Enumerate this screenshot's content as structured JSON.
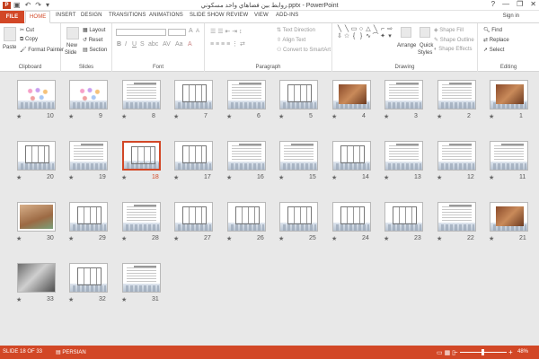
{
  "window": {
    "title": "روابط بين فضاهاي واحد مسكوني.pptx - PowerPoint",
    "app_badge": "P",
    "sign_in": "Sign in",
    "help": "?",
    "minimize": "—",
    "restore": "❐",
    "close": "✕"
  },
  "qat": {
    "save": "▣",
    "undo": "↶",
    "redo": "↷",
    "customize": "▾"
  },
  "tabs": [
    "FILE",
    "HOME",
    "INSERT",
    "DESIGN",
    "TRANSITIONS",
    "ANIMATIONS",
    "SLIDE SHOW",
    "REVIEW",
    "VIEW",
    "ADD-INS"
  ],
  "ribbon": {
    "clipboard": {
      "label": "Clipboard",
      "paste": "Paste",
      "cut": "Cut",
      "copy": "Copy",
      "format_painter": "Format Painter"
    },
    "slides": {
      "label": "Slides",
      "new_slide": "New",
      "new_slide2": "Slide",
      "layout": "Layout",
      "reset": "Reset",
      "section": "Section"
    },
    "font": {
      "label": "Font"
    },
    "paragraph": {
      "label": "Paragraph",
      "text_direction": "Text Direction",
      "align_text": "Align Text",
      "convert_smartart": "Convert to SmartArt"
    },
    "drawing": {
      "label": "Drawing",
      "arrange": "Arrange",
      "quick_styles": "Quick",
      "quick_styles2": "Styles",
      "shape_fill": "Shape Fill",
      "shape_outline": "Shape Outline",
      "shape_effects": "Shape Effects"
    },
    "editing": {
      "label": "Editing",
      "find": "Find",
      "replace": "Replace",
      "select": "Select"
    }
  },
  "slides": [
    {
      "num": "10",
      "kind": "dots"
    },
    {
      "num": "9",
      "kind": "dots"
    },
    {
      "num": "8",
      "kind": "text"
    },
    {
      "num": "7",
      "kind": "plan"
    },
    {
      "num": "6",
      "kind": "text"
    },
    {
      "num": "5",
      "kind": "plan"
    },
    {
      "num": "4",
      "kind": "photo"
    },
    {
      "num": "3",
      "kind": "text"
    },
    {
      "num": "2",
      "kind": "text"
    },
    {
      "num": "1",
      "kind": "photo"
    },
    {
      "num": "20",
      "kind": "plan"
    },
    {
      "num": "19",
      "kind": "text"
    },
    {
      "num": "18",
      "kind": "plan",
      "selected": true
    },
    {
      "num": "17",
      "kind": "plan"
    },
    {
      "num": "16",
      "kind": "text"
    },
    {
      "num": "15",
      "kind": "text"
    },
    {
      "num": "14",
      "kind": "plan"
    },
    {
      "num": "13",
      "kind": "text"
    },
    {
      "num": "12",
      "kind": "text"
    },
    {
      "num": "11",
      "kind": "text"
    },
    {
      "num": "30",
      "kind": "photo2"
    },
    {
      "num": "29",
      "kind": "plan"
    },
    {
      "num": "28",
      "kind": "text"
    },
    {
      "num": "27",
      "kind": "plan"
    },
    {
      "num": "26",
      "kind": "plan"
    },
    {
      "num": "25",
      "kind": "plan"
    },
    {
      "num": "24",
      "kind": "plan"
    },
    {
      "num": "23",
      "kind": "plan"
    },
    {
      "num": "22",
      "kind": "text"
    },
    {
      "num": "21",
      "kind": "photo"
    },
    {
      "num": "33",
      "kind": "laptop"
    },
    {
      "num": "32",
      "kind": "plan"
    },
    {
      "num": "31",
      "kind": "text"
    }
  ],
  "status": {
    "slide_counter": "SLIDE 18 OF 33",
    "language": "PERSIAN",
    "zoom": "48%",
    "zoom_minus": "−",
    "zoom_plus": "+"
  }
}
